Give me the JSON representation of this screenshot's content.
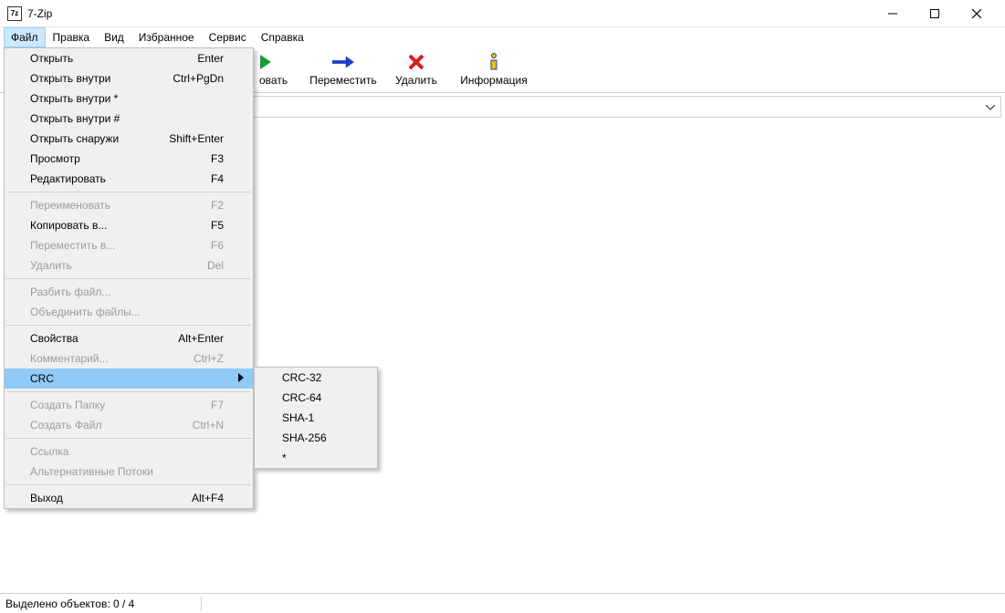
{
  "titlebar": {
    "app_icon_text": "7z",
    "title": "7-Zip"
  },
  "menubar": {
    "items": [
      {
        "label": "Файл"
      },
      {
        "label": "Правка"
      },
      {
        "label": "Вид"
      },
      {
        "label": "Избранное"
      },
      {
        "label": "Сервис"
      },
      {
        "label": "Справка"
      }
    ]
  },
  "toolbar": {
    "copy_partial": "овать",
    "move": "Переместить",
    "delete": "Удалить",
    "info": "Информация"
  },
  "file_menu": {
    "open": {
      "label": "Открыть",
      "shortcut": "Enter"
    },
    "open_inside": {
      "label": "Открыть внутри",
      "shortcut": "Ctrl+PgDn"
    },
    "open_inside_star": {
      "label": "Открыть внутри *",
      "shortcut": ""
    },
    "open_inside_hash": {
      "label": "Открыть внутри #",
      "shortcut": ""
    },
    "open_outside": {
      "label": "Открыть снаружи",
      "shortcut": "Shift+Enter"
    },
    "view": {
      "label": "Просмотр",
      "shortcut": "F3"
    },
    "edit": {
      "label": "Редактировать",
      "shortcut": "F4"
    },
    "rename": {
      "label": "Переименовать",
      "shortcut": "F2"
    },
    "copy_to": {
      "label": "Копировать в...",
      "shortcut": "F5"
    },
    "move_to": {
      "label": "Переместить в...",
      "shortcut": "F6"
    },
    "delete": {
      "label": "Удалить",
      "shortcut": "Del"
    },
    "split": {
      "label": "Разбить файл...",
      "shortcut": ""
    },
    "combine": {
      "label": "Объединить файлы...",
      "shortcut": ""
    },
    "properties": {
      "label": "Свойства",
      "shortcut": "Alt+Enter"
    },
    "comment": {
      "label": "Комментарий...",
      "shortcut": "Ctrl+Z"
    },
    "crc": {
      "label": "CRC",
      "shortcut": ""
    },
    "create_folder": {
      "label": "Создать Папку",
      "shortcut": "F7"
    },
    "create_file": {
      "label": "Создать Файл",
      "shortcut": "Ctrl+N"
    },
    "link": {
      "label": "Ссылка",
      "shortcut": ""
    },
    "alt_streams": {
      "label": "Альтернативные Потоки",
      "shortcut": ""
    },
    "exit": {
      "label": "Выход",
      "shortcut": "Alt+F4"
    }
  },
  "crc_submenu": {
    "crc32": "CRC-32",
    "crc64": "CRC-64",
    "sha1": "SHA-1",
    "sha256": "SHA-256",
    "star": "*"
  },
  "statusbar": {
    "selected": "Выделено объектов: 0 / 4"
  }
}
